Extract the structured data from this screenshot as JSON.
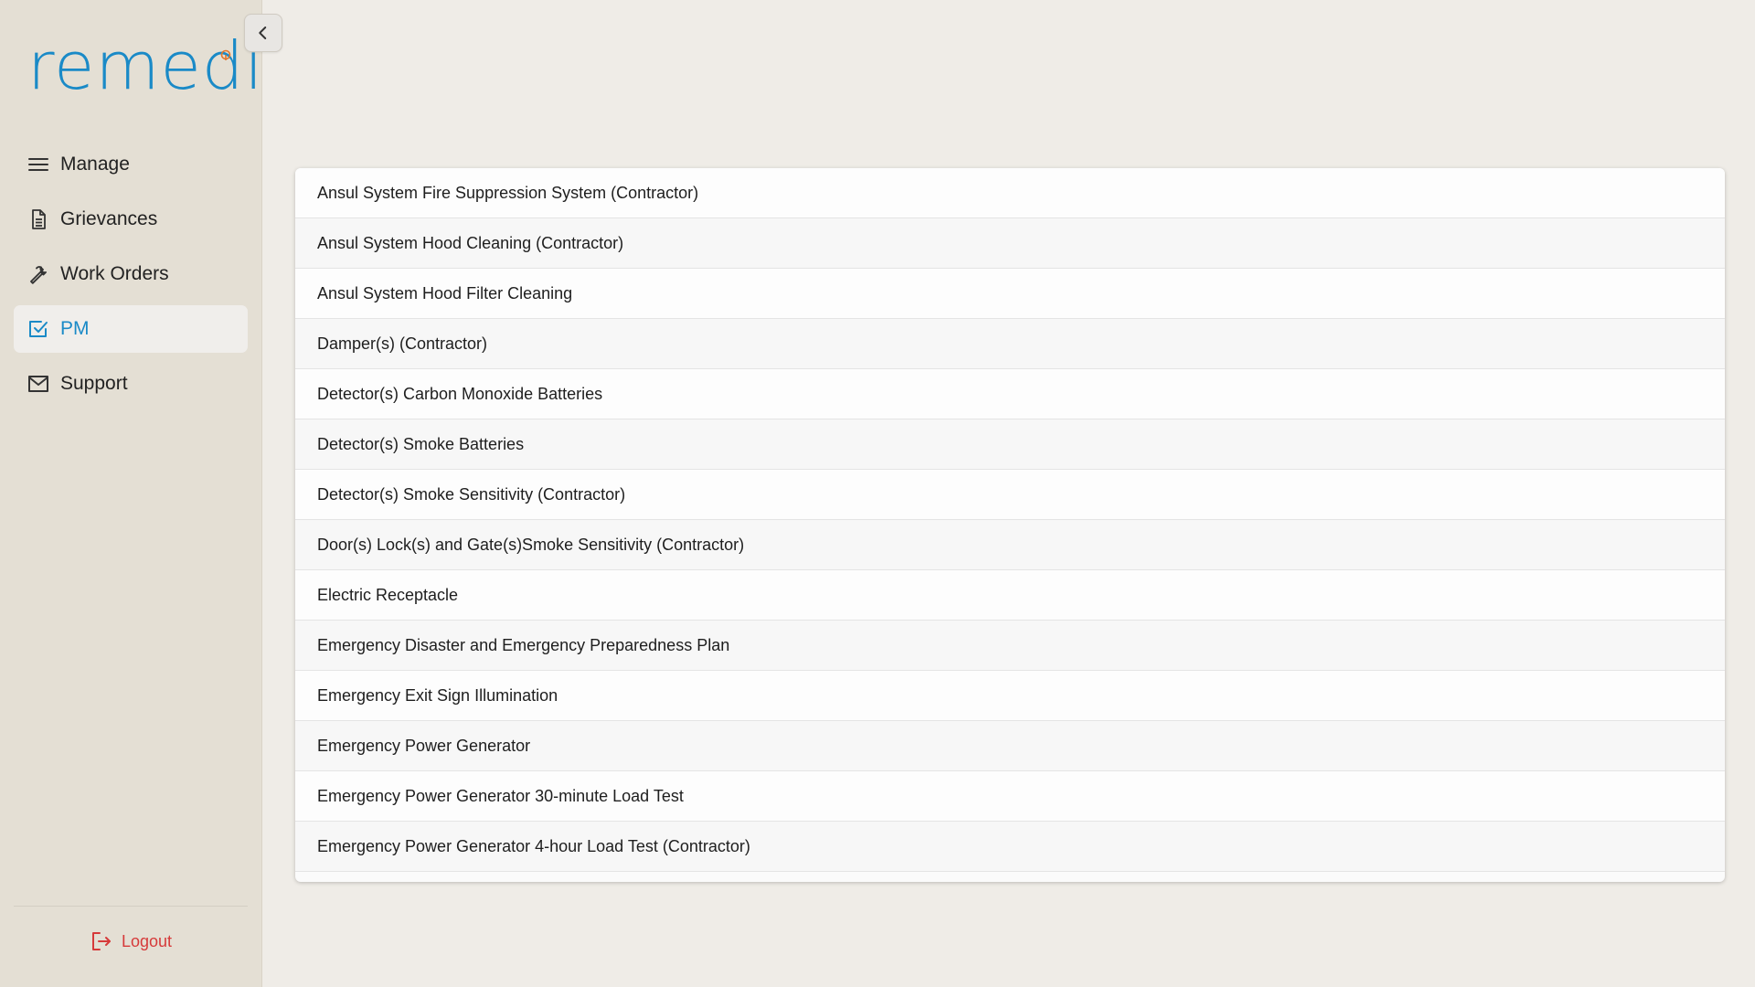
{
  "app": {
    "logo_text": "remedi",
    "accent_color": "#1a8ac7",
    "logo_dot_color": "#e0762a"
  },
  "sidebar": {
    "collapse_icon": "chevron-left-icon",
    "items": [
      {
        "label": "Manage",
        "icon": "menu-icon",
        "active": false
      },
      {
        "label": "Grievances",
        "icon": "document-icon",
        "active": false
      },
      {
        "label": "Work Orders",
        "icon": "wrench-icon",
        "active": false
      },
      {
        "label": "PM",
        "icon": "checkbox-icon",
        "active": true
      },
      {
        "label": "Support",
        "icon": "mail-icon",
        "active": false
      }
    ],
    "logout_label": "Logout",
    "logout_color": "#d63a3a"
  },
  "list": {
    "items": [
      "Ansul System Fire Suppression System (Contractor)",
      "Ansul System Hood Cleaning (Contractor)",
      "Ansul System Hood Filter Cleaning",
      "Damper(s) (Contractor)",
      "Detector(s) Carbon Monoxide Batteries",
      "Detector(s) Smoke Batteries",
      "Detector(s) Smoke Sensitivity (Contractor)",
      "Door(s) Lock(s) and Gate(s)Smoke Sensitivity (Contractor)",
      "Electric Receptacle",
      "Emergency Disaster and Emergency Preparedness Plan",
      "Emergency Exit Sign Illumination",
      "Emergency Power Generator",
      "Emergency Power Generator 30-minute Load Test",
      "Emergency Power Generator 4-hour Load Test (Contractor)"
    ]
  }
}
